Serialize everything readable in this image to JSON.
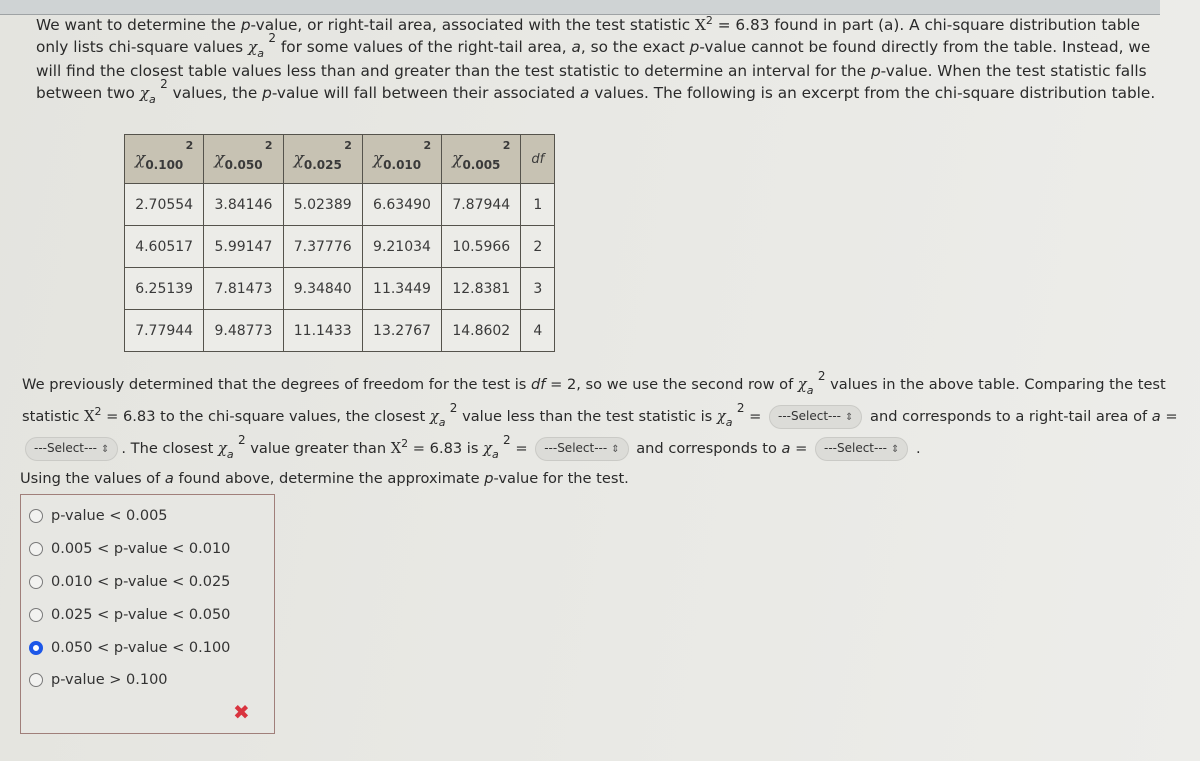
{
  "intro": {
    "t1": "We want to determine the ",
    "p": "p",
    "t2": "-value, or right-tail area, associated with the test statistic ",
    "X2": "X",
    "sq": "2",
    "t3": " = 6.83 found in part (a). A chi-square distribution table only lists chi-square values ",
    "chi": "χ",
    "a": "a",
    "t4": " for some values of the right-tail area, ",
    "t5": ", so the exact ",
    "t6": "-value cannot be found directly from the table. Instead, we will find the closest table values less than and greater than the test statistic to determine an interval for the ",
    "t7": "-value. When the test statistic falls between two ",
    "t8": " values, the ",
    "t9": "-value will fall between their associated ",
    "t10": " values. The following is an excerpt from the chi-square distribution table."
  },
  "table": {
    "headers": [
      {
        "sub": "0.100",
        "sup": "2"
      },
      {
        "sub": "0.050",
        "sup": "2"
      },
      {
        "sub": "0.025",
        "sup": "2"
      },
      {
        "sub": "0.010",
        "sup": "2"
      },
      {
        "sub": "0.005",
        "sup": "2"
      }
    ],
    "df_label": "df",
    "rows": [
      [
        "2.70554",
        "3.84146",
        "5.02389",
        "6.63490",
        "7.87944",
        "1"
      ],
      [
        "4.60517",
        "5.99147",
        "7.37776",
        "9.21034",
        "10.5966",
        "2"
      ],
      [
        "6.25139",
        "7.81473",
        "9.34840",
        "11.3449",
        "12.8381",
        "3"
      ],
      [
        "7.77944",
        "9.48773",
        "11.1433",
        "13.2767",
        "14.8602",
        "4"
      ]
    ]
  },
  "para2": {
    "t1": "We previously determined that the degrees of freedom for the test is ",
    "df": "df",
    "t2": " = 2, so we use the second row of ",
    "t3": " values in the above table. Comparing the test statistic ",
    "t4": " = 6.83 to the chi-square values, the closest ",
    "t5": " value less than the test statistic is ",
    "t6": " = ",
    "t7": " and corresponds to a right-tail area of ",
    "t8": " = ",
    "t9": ". The closest ",
    "t10": " value greater than ",
    "t11": " = 6.83 is ",
    "t12": " = ",
    "t13": " and corresponds to ",
    "t14": " = ",
    "t15": " ."
  },
  "selects": [
    {
      "value": "---Select---"
    },
    {
      "value": "---Select---"
    },
    {
      "value": "---Select---"
    },
    {
      "value": "---Select---"
    }
  ],
  "question": {
    "t1": "Using the values of ",
    "a": "a",
    "t2": " found above, determine the approximate ",
    "p": "p",
    "t3": "-value for the test."
  },
  "choices": [
    {
      "label": "p-value < 0.005",
      "selected": false
    },
    {
      "label": "0.005 < p-value < 0.010",
      "selected": false
    },
    {
      "label": "0.010 < p-value < 0.025",
      "selected": false
    },
    {
      "label": "0.025 < p-value < 0.050",
      "selected": false
    },
    {
      "label": "0.050 < p-value < 0.100",
      "selected": true
    },
    {
      "label": "p-value > 0.100",
      "selected": false
    }
  ],
  "feedback": {
    "icon": "incorrect-x-icon",
    "glyph": "✖",
    "color": "#d9343f"
  },
  "accent": "#1d57e8"
}
